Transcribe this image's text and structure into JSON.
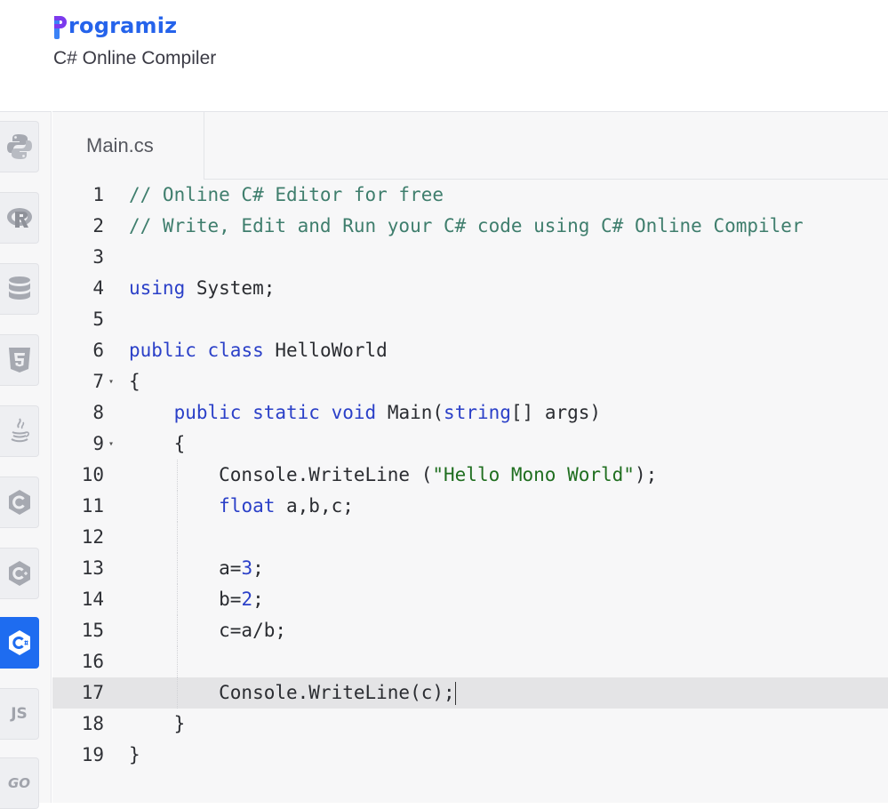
{
  "header": {
    "logo_text": "rogramiz",
    "subtitle": "C# Online Compiler"
  },
  "sidebar": {
    "items": [
      {
        "name": "python",
        "icon": "python-icon",
        "active": false
      },
      {
        "name": "r",
        "icon": "r-icon",
        "active": false
      },
      {
        "name": "sql",
        "icon": "database-icon",
        "active": false
      },
      {
        "name": "html",
        "icon": "html5-icon",
        "active": false
      },
      {
        "name": "java",
        "icon": "java-icon",
        "active": false
      },
      {
        "name": "c",
        "icon": "c-icon",
        "active": false
      },
      {
        "name": "cpp",
        "icon": "cpp-icon",
        "active": false
      },
      {
        "name": "csharp",
        "icon": "csharp-icon",
        "active": true
      },
      {
        "name": "js",
        "icon": "js-icon",
        "label": "JS",
        "active": false
      },
      {
        "name": "go",
        "icon": "go-icon",
        "label": "GO",
        "active": false
      }
    ]
  },
  "editor": {
    "tab_label": "Main.cs",
    "active_line": 17,
    "lines": [
      {
        "n": "1",
        "tokens": [
          [
            "c",
            "// Online C# Editor for free"
          ]
        ]
      },
      {
        "n": "2",
        "tokens": [
          [
            "c",
            "// Write, Edit and Run your C# code using C# Online Compiler"
          ]
        ]
      },
      {
        "n": "3",
        "tokens": []
      },
      {
        "n": "4",
        "tokens": [
          [
            "k",
            "using"
          ],
          [
            "t",
            " System;"
          ]
        ]
      },
      {
        "n": "5",
        "tokens": []
      },
      {
        "n": "6",
        "tokens": [
          [
            "k",
            "public"
          ],
          [
            "t",
            " "
          ],
          [
            "k",
            "class"
          ],
          [
            "t",
            " HelloWorld"
          ]
        ]
      },
      {
        "n": "7",
        "fold": true,
        "tokens": [
          [
            "t",
            "{"
          ]
        ]
      },
      {
        "n": "8",
        "tokens": [
          [
            "t",
            "    "
          ],
          [
            "k",
            "public"
          ],
          [
            "t",
            " "
          ],
          [
            "k",
            "static"
          ],
          [
            "t",
            " "
          ],
          [
            "k",
            "void"
          ],
          [
            "t",
            " Main("
          ],
          [
            "k",
            "string"
          ],
          [
            "t",
            "[] args)"
          ]
        ]
      },
      {
        "n": "9",
        "fold": true,
        "tokens": [
          [
            "t",
            "    {"
          ]
        ]
      },
      {
        "n": "10",
        "tokens": [
          [
            "t",
            "        Console.WriteLine ("
          ],
          [
            "s",
            "\"Hello Mono World\""
          ],
          [
            "t",
            ");"
          ]
        ]
      },
      {
        "n": "11",
        "tokens": [
          [
            "t",
            "        "
          ],
          [
            "k",
            "float"
          ],
          [
            "t",
            " a,b,c;"
          ]
        ]
      },
      {
        "n": "12",
        "tokens": []
      },
      {
        "n": "13",
        "tokens": [
          [
            "t",
            "        a="
          ],
          [
            "n",
            "3"
          ],
          [
            "t",
            ";"
          ]
        ]
      },
      {
        "n": "14",
        "tokens": [
          [
            "t",
            "        b="
          ],
          [
            "n",
            "2"
          ],
          [
            "t",
            ";"
          ]
        ]
      },
      {
        "n": "15",
        "tokens": [
          [
            "t",
            "        c=a/b;"
          ]
        ]
      },
      {
        "n": "16",
        "tokens": []
      },
      {
        "n": "17",
        "tokens": [
          [
            "t",
            "        Console.WriteLine(c);"
          ]
        ]
      },
      {
        "n": "18",
        "tokens": [
          [
            "t",
            "    }"
          ]
        ]
      },
      {
        "n": "19",
        "tokens": [
          [
            "t",
            "}"
          ]
        ]
      }
    ]
  }
}
